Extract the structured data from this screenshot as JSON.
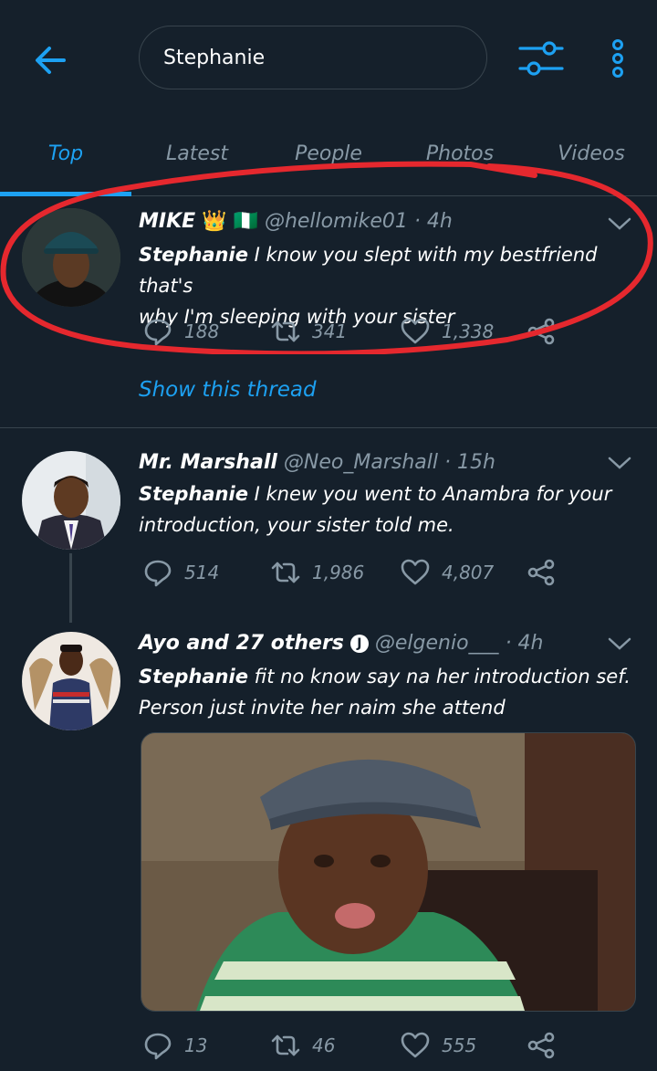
{
  "header": {
    "search_value": "Stephanie",
    "accent": "#1da1f2"
  },
  "tabs": [
    {
      "label": "Top",
      "active": true
    },
    {
      "label": "Latest",
      "active": false
    },
    {
      "label": "People",
      "active": false
    },
    {
      "label": "Photos",
      "active": false
    },
    {
      "label": "Videos",
      "active": false
    }
  ],
  "tweets": [
    {
      "name": "MIKE",
      "emojis": "👑 🇳🇬",
      "handle": "@hellomike01",
      "time": "· 4h",
      "bold_word": "Stephanie",
      "text_line1": " I know you slept with my bestfriend that's",
      "text_line2": "why I'm sleeping with your sister",
      "replies": "188",
      "retweets": "341",
      "likes": "1,338",
      "show_thread": "Show this thread"
    },
    {
      "name": "Mr. Marshall",
      "handle": "@Neo_Marshall",
      "time": "· 15h",
      "bold_word": "Stephanie",
      "text_line1": " I knew you went to Anambra for your",
      "text_line2": "introduction, your sister told me.",
      "replies": "514",
      "retweets": "1,986",
      "likes": "4,807"
    },
    {
      "name": "Ayo and 27 others",
      "badge": "J",
      "handle": "@elgenio___",
      "time": "· 4h",
      "bold_word": "Stephanie",
      "text_line1": " fit no know say na her introduction sef.",
      "text_line2": "Person just invite her naim she attend",
      "replies": "13",
      "retweets": "46",
      "likes": "555"
    }
  ]
}
